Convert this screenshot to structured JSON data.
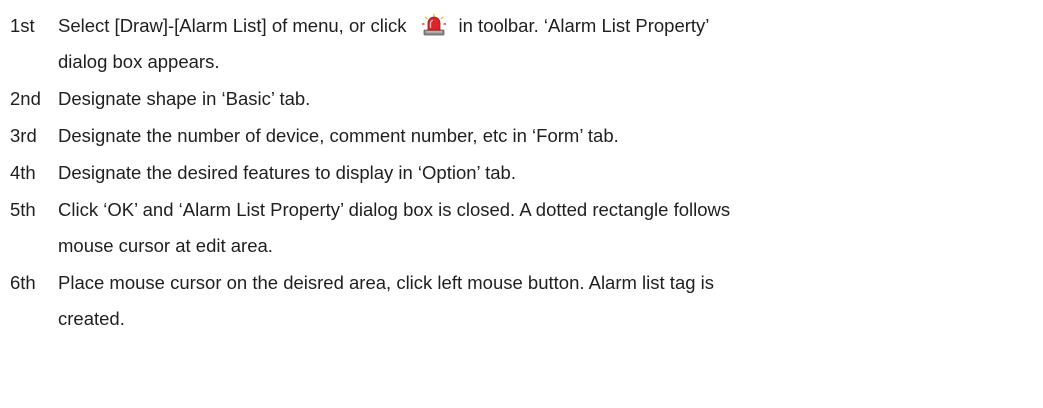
{
  "steps": [
    {
      "num": "1st",
      "pre": "Select [Draw]-[Alarm List] of menu, or click",
      "icon": "alarm-list-toolbar-icon",
      "post": "in toolbar. ‘Alarm List Property’",
      "cont": "dialog box appears."
    },
    {
      "num": "2nd",
      "text": "Designate shape in ‘Basic’ tab."
    },
    {
      "num": "3rd",
      "text": "Designate the number of device, comment number, etc in ‘Form’ tab."
    },
    {
      "num": "4th",
      "text": "Designate the desired features to display in ‘Option’ tab."
    },
    {
      "num": "5th",
      "text": "Click ‘OK’ and ‘Alarm List Property’ dialog box is closed. A dotted rectangle follows",
      "cont": "mouse cursor at edit area."
    },
    {
      "num": "6th",
      "text": "Place mouse cursor on the deisred area, click left mouse button. Alarm list tag is",
      "cont": "created."
    }
  ],
  "colors": {
    "text": "#1f1f1f",
    "icon_red": "#d9262b",
    "icon_gray": "#8c8c8c",
    "icon_yellow": "#f2c230"
  }
}
